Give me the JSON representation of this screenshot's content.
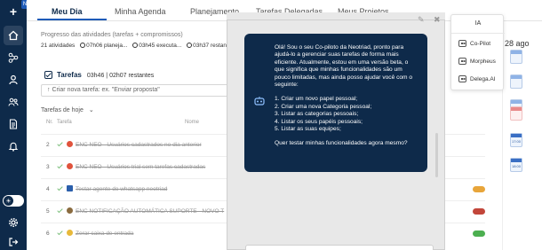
{
  "sidebar": {
    "plus_label": "+",
    "badge": "N",
    "theme_toggle_icon": "sun-icon"
  },
  "tabs": [
    {
      "label": "Meu Dia",
      "active": true
    },
    {
      "label": "Minha Agenda"
    },
    {
      "label": "Planejamento"
    },
    {
      "label": "Tarefas Delegadas"
    },
    {
      "label": "Meus Projetos"
    }
  ],
  "progress": {
    "title": "Progresso das atividades (tarefas + compromissos)",
    "activities": "21 atividades",
    "planned": "07h06 planeja...",
    "executed": "03h45 executa...",
    "remaining": "03h37 restant"
  },
  "tasks": {
    "title": "Tarefas",
    "done_time": "03h46",
    "remaining": "02h07 restantes",
    "new_task_placeholder": "Criar nova tarefa: ex. \"Enviar proposta\"",
    "today_label": "Tarefas de hoje",
    "col_no": "Nr.",
    "col_task": "Tarefa",
    "col_name": "Nome",
    "rows": [
      {
        "num": "2",
        "text": "ENC NEO - Usuários cadastrados no dia anterior",
        "emoji_color": "#e0533c"
      },
      {
        "num": "3",
        "text": "ENC NEO - Usuários trial sem tarefas cadastradas",
        "emoji_color": "#e0533c"
      },
      {
        "num": "4",
        "text": "Testar agente do whatsapp neotriad",
        "emoji_color": "#2b5fab",
        "pill": "#e8a53a"
      },
      {
        "num": "5",
        "text": "ENC NOTIFICAÇÃO AUTOMÁTICA SUPORTE - NOVO T",
        "emoji_color": "#8a6b3f",
        "pill": "#c2463a"
      },
      {
        "num": "6",
        "text": "Zerar caixa de entrada",
        "emoji_color": "#e8b93a",
        "pill": "#4caf50"
      }
    ]
  },
  "calendar": {
    "date_label": "28 ago",
    "icons": [
      {
        "type": "blue",
        "text": ""
      },
      {
        "type": "blue",
        "text": ""
      },
      {
        "type": "blue",
        "text": ""
      },
      {
        "type": "red",
        "text": ""
      },
      {
        "type": "dark",
        "text": "17:00"
      },
      {
        "type": "dark",
        "text": "18:00"
      }
    ]
  },
  "chat": {
    "greeting": "Olá! Sou o seu Co-piloto da Neotriad, pronto para ajudá-lo a gerenciar suas tarefas de forma mais eficiente. Atualmente, estou em uma versão beta, o que significa que minhas funcionalidades são um pouco limitadas, mas ainda posso ajudar você com o seguinte:",
    "items": [
      "1. Criar um novo papel pessoal;",
      "2. Criar uma nova Categoria pessoal;",
      "3. Listar as categorias pessoais;",
      "4. Listar os seus papéis pessoais;",
      "5. Listar as suas equipes;"
    ],
    "question": "Quer testar minhas funcionalidades agora mesmo?"
  },
  "ia_menu": {
    "title": "IA",
    "items": [
      {
        "label": "Co-Pilot",
        "icon": "robot-icon"
      },
      {
        "label": "Morpheus",
        "icon": "robot-icon"
      },
      {
        "label": "Delega.AI",
        "icon": "robot-icon"
      }
    ]
  }
}
